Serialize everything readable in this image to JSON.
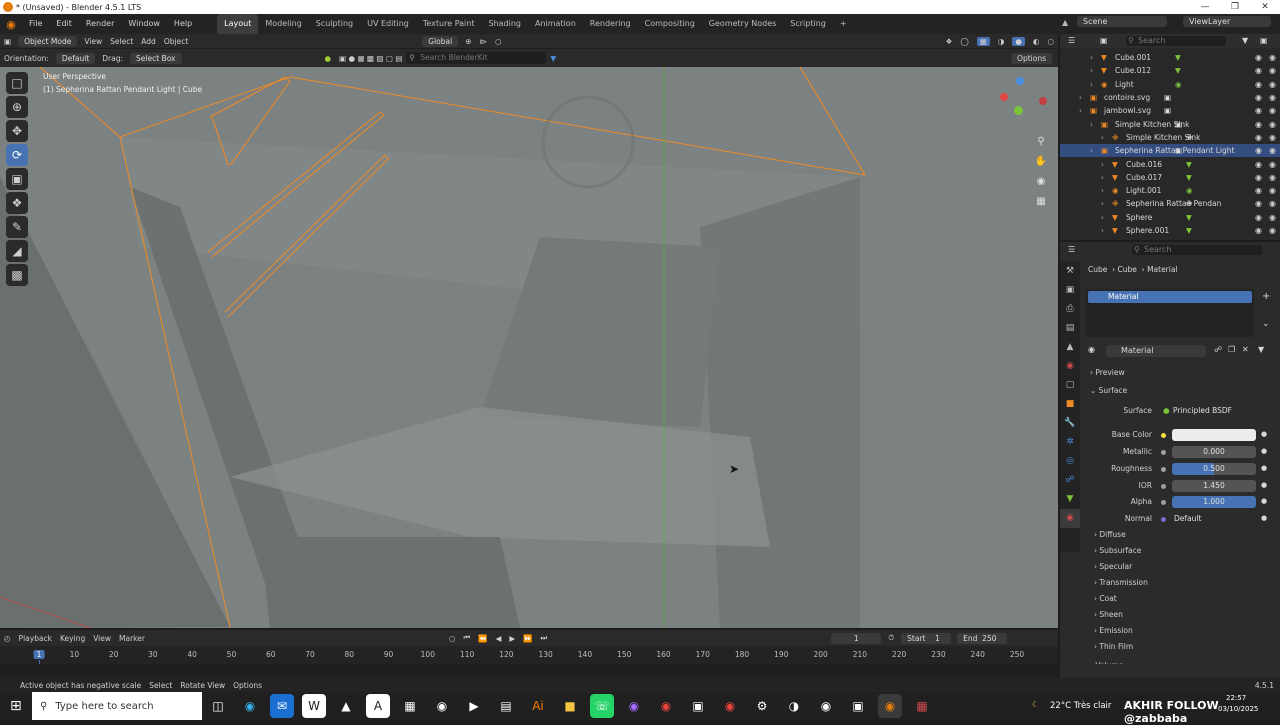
{
  "window": {
    "title": "* (Unsaved) - Blender 4.5.1 LTS"
  },
  "menu": [
    "File",
    "Edit",
    "Render",
    "Window",
    "Help"
  ],
  "workspaces": [
    "Layout",
    "Modeling",
    "Sculpting",
    "UV Editing",
    "Texture Paint",
    "Shading",
    "Animation",
    "Rendering",
    "Compositing",
    "Geometry Nodes",
    "Scripting"
  ],
  "scene": {
    "label": "Scene",
    "viewlayer": "ViewLayer"
  },
  "viewport_header": {
    "mode": "Object Mode",
    "menus": [
      "View",
      "Select",
      "Add",
      "Object"
    ],
    "transform": "Global",
    "orientation_label": "Orientation:",
    "orientation": "Default",
    "drag_label": "Drag:",
    "drag": "Select Box",
    "search_placeholder": "Search BlenderKit",
    "options": "Options"
  },
  "viewport": {
    "perspective": "User Perspective",
    "active": "(1) Sepherina Rattan Pendant Light | Cube"
  },
  "outliner": {
    "search_placeholder": "Search",
    "rows": [
      {
        "label": "Cube.001",
        "icon": "mesh-icon"
      },
      {
        "label": "Cube.012",
        "icon": "mesh-icon"
      },
      {
        "label": "Light",
        "icon": "light-icon"
      },
      {
        "label": "contoire.svg",
        "icon": "collection-icon"
      },
      {
        "label": "jambowl.svg",
        "icon": "collection-icon"
      },
      {
        "label": "Simple Kitchen Sink",
        "icon": "collection-icon"
      },
      {
        "label": "Simple Kitchen Sink",
        "icon": "empty-icon"
      },
      {
        "label": "Sepherina Rattan Pendant Light",
        "icon": "collection-icon"
      },
      {
        "label": "Cube.016",
        "icon": "mesh-icon"
      },
      {
        "label": "Cube.017",
        "icon": "mesh-icon"
      },
      {
        "label": "Light.001",
        "icon": "light-icon"
      },
      {
        "label": "Sepherina Rattan Pendan",
        "icon": "empty-icon"
      },
      {
        "label": "Sphere",
        "icon": "mesh-icon"
      },
      {
        "label": "Sphere.001",
        "icon": "mesh-icon"
      }
    ]
  },
  "properties": {
    "search_placeholder": "Search",
    "breadcrumb": [
      "Cube",
      "Cube",
      "Material"
    ],
    "material_slot": "Material",
    "material_name": "Material",
    "sections": {
      "preview": "Preview",
      "surface": "Surface"
    },
    "surface": {
      "label": "Surface",
      "value": "Principled BSDF"
    },
    "fields": [
      {
        "label": "Base Color",
        "value": "",
        "kind": "color"
      },
      {
        "label": "Metallic",
        "value": "0.000",
        "kind": "num"
      },
      {
        "label": "Roughness",
        "value": "0.500",
        "kind": "slider",
        "fill": 0.5
      },
      {
        "label": "IOR",
        "value": "1.450",
        "kind": "num"
      },
      {
        "label": "Alpha",
        "value": "1.000",
        "kind": "slider",
        "fill": 1.0
      },
      {
        "label": "Normal",
        "value": "Default",
        "kind": "link"
      }
    ],
    "subpanels": [
      "Diffuse",
      "Subsurface",
      "Specular",
      "Transmission",
      "Coat",
      "Sheen",
      "Emission",
      "Thin Film",
      "Volume"
    ]
  },
  "timeline": {
    "menus": [
      "Playback",
      "Keying",
      "View",
      "Marker"
    ],
    "current_frame": "1",
    "start_label": "Start",
    "start": "1",
    "end_label": "End",
    "end": "250",
    "ticks": [
      "1",
      "10",
      "20",
      "30",
      "40",
      "50",
      "60",
      "70",
      "80",
      "90",
      "100",
      "110",
      "120",
      "130",
      "140",
      "150",
      "160",
      "170",
      "180",
      "190",
      "200",
      "210",
      "220",
      "230",
      "240",
      "250"
    ]
  },
  "status": {
    "message": "Active object has negative scale",
    "hints": [
      "Select",
      "Rotate View",
      "Options"
    ],
    "version": "4.5.1"
  },
  "taskbar": {
    "search_placeholder": "Type here to search",
    "weather": "22°C  Très clair",
    "time": "22:57",
    "date": "03/10/2025",
    "overlay_text": "AKHIR FOLLOW @zabbaba"
  },
  "colors": {
    "accent": "#4772b3",
    "selection_outline": "#f08a24",
    "viewport": "#7b8080"
  }
}
